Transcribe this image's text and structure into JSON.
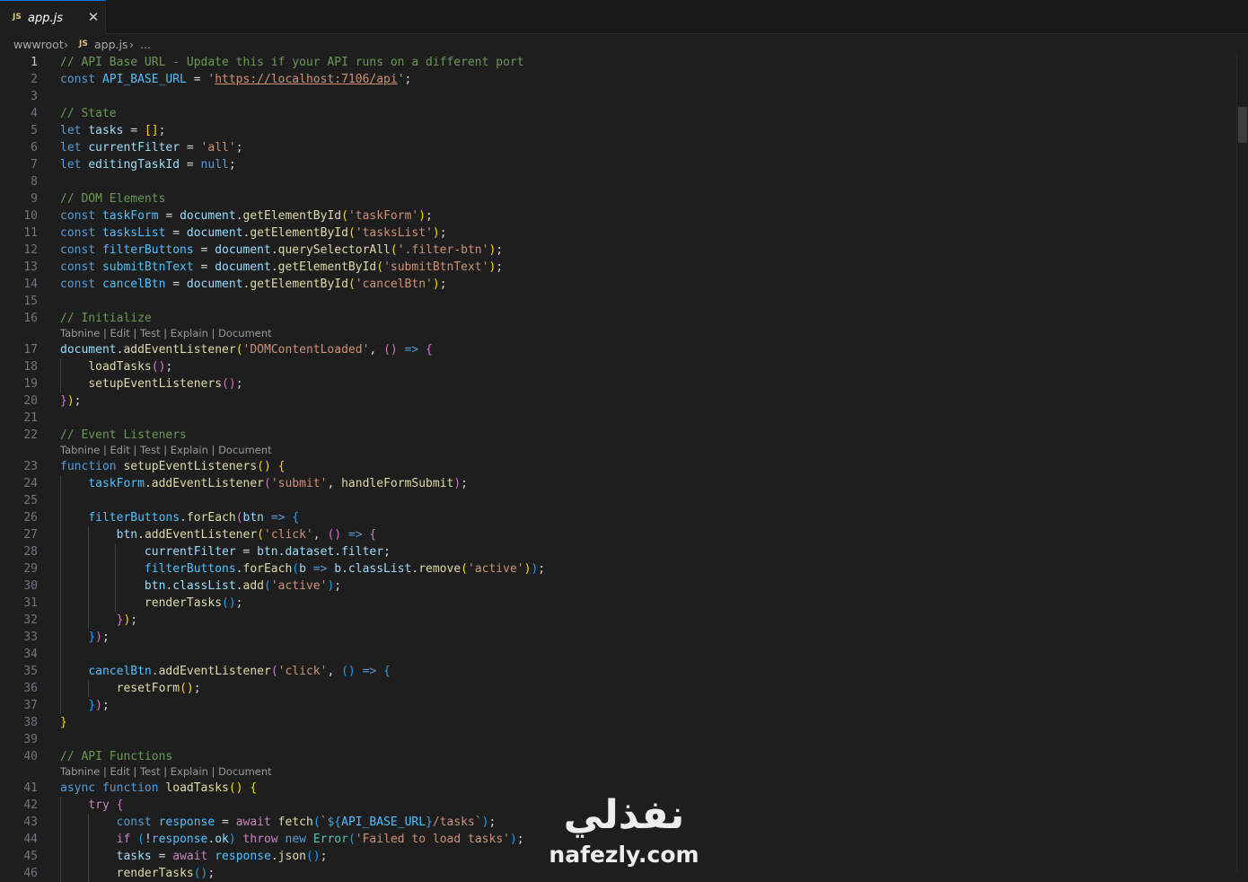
{
  "tab": {
    "file": "app.js",
    "lang_badge": "JS",
    "close_glyph": "✕"
  },
  "breadcrumb": {
    "root": "wwwroot",
    "sep": "›",
    "lang_badge": "JS",
    "file": "app.js",
    "more": "..."
  },
  "codelens_text": "Tabnine | Edit | Test | Explain | Document",
  "colors": {
    "comment": "#6a9955",
    "keyword": "#569cd6",
    "control": "#c586c0",
    "variable": "#9cdcfe",
    "constant": "#4fc1ff",
    "function": "#dcdcaa",
    "string": "#ce9178",
    "class": "#4ec9b0",
    "plain": "#d4d4d4",
    "bracket1": "#ffd700",
    "bracket2": "#da70d6",
    "bracket3": "#179fff"
  },
  "lines": [
    {
      "n": "1",
      "current": true,
      "tokens": [
        [
          "// API Base URL - Update this if your API runs on a different port",
          "comment"
        ]
      ]
    },
    {
      "n": "2",
      "tokens": [
        [
          "const ",
          "keyword"
        ],
        [
          "API_BASE_URL",
          "constant"
        ],
        [
          " = ",
          "plain"
        ],
        [
          "'",
          "string"
        ],
        [
          "https://localhost:7106/api",
          "string-link"
        ],
        [
          "'",
          "string"
        ],
        [
          ";",
          "plain"
        ]
      ]
    },
    {
      "n": "3",
      "tokens": []
    },
    {
      "n": "4",
      "tokens": [
        [
          "// State",
          "comment"
        ]
      ]
    },
    {
      "n": "5",
      "tokens": [
        [
          "let ",
          "keyword"
        ],
        [
          "tasks",
          "variable"
        ],
        [
          " = ",
          "plain"
        ],
        [
          "[]",
          "bracket1"
        ],
        [
          ";",
          "plain"
        ]
      ]
    },
    {
      "n": "6",
      "tokens": [
        [
          "let ",
          "keyword"
        ],
        [
          "currentFilter",
          "variable"
        ],
        [
          " = ",
          "plain"
        ],
        [
          "'all'",
          "string"
        ],
        [
          ";",
          "plain"
        ]
      ]
    },
    {
      "n": "7",
      "tokens": [
        [
          "let ",
          "keyword"
        ],
        [
          "editingTaskId",
          "variable"
        ],
        [
          " = ",
          "plain"
        ],
        [
          "null",
          "keyword"
        ],
        [
          ";",
          "plain"
        ]
      ]
    },
    {
      "n": "8",
      "tokens": []
    },
    {
      "n": "9",
      "tokens": [
        [
          "// DOM Elements",
          "comment"
        ]
      ]
    },
    {
      "n": "10",
      "tokens": [
        [
          "const ",
          "keyword"
        ],
        [
          "taskForm",
          "constant"
        ],
        [
          " = ",
          "plain"
        ],
        [
          "document",
          "variable"
        ],
        [
          ".",
          "plain"
        ],
        [
          "getElementById",
          "function"
        ],
        [
          "(",
          "bracket1"
        ],
        [
          "'taskForm'",
          "string"
        ],
        [
          ")",
          "bracket1"
        ],
        [
          ";",
          "plain"
        ]
      ]
    },
    {
      "n": "11",
      "tokens": [
        [
          "const ",
          "keyword"
        ],
        [
          "tasksList",
          "constant"
        ],
        [
          " = ",
          "plain"
        ],
        [
          "document",
          "variable"
        ],
        [
          ".",
          "plain"
        ],
        [
          "getElementById",
          "function"
        ],
        [
          "(",
          "bracket1"
        ],
        [
          "'tasksList'",
          "string"
        ],
        [
          ")",
          "bracket1"
        ],
        [
          ";",
          "plain"
        ]
      ]
    },
    {
      "n": "12",
      "tokens": [
        [
          "const ",
          "keyword"
        ],
        [
          "filterButtons",
          "constant"
        ],
        [
          " = ",
          "plain"
        ],
        [
          "document",
          "variable"
        ],
        [
          ".",
          "plain"
        ],
        [
          "querySelectorAll",
          "function"
        ],
        [
          "(",
          "bracket1"
        ],
        [
          "'.filter-btn'",
          "string"
        ],
        [
          ")",
          "bracket1"
        ],
        [
          ";",
          "plain"
        ]
      ]
    },
    {
      "n": "13",
      "tokens": [
        [
          "const ",
          "keyword"
        ],
        [
          "submitBtnText",
          "constant"
        ],
        [
          " = ",
          "plain"
        ],
        [
          "document",
          "variable"
        ],
        [
          ".",
          "plain"
        ],
        [
          "getElementById",
          "function"
        ],
        [
          "(",
          "bracket1"
        ],
        [
          "'submitBtnText'",
          "string"
        ],
        [
          ")",
          "bracket1"
        ],
        [
          ";",
          "plain"
        ]
      ]
    },
    {
      "n": "14",
      "tokens": [
        [
          "const ",
          "keyword"
        ],
        [
          "cancelBtn",
          "constant"
        ],
        [
          " = ",
          "plain"
        ],
        [
          "document",
          "variable"
        ],
        [
          ".",
          "plain"
        ],
        [
          "getElementById",
          "function"
        ],
        [
          "(",
          "bracket1"
        ],
        [
          "'cancelBtn'",
          "string"
        ],
        [
          ")",
          "bracket1"
        ],
        [
          ";",
          "plain"
        ]
      ]
    },
    {
      "n": "15",
      "tokens": []
    },
    {
      "n": "16",
      "tokens": [
        [
          "// Initialize",
          "comment"
        ]
      ],
      "lens_after": true
    },
    {
      "n": "17",
      "tokens": [
        [
          "document",
          "variable"
        ],
        [
          ".",
          "plain"
        ],
        [
          "addEventListener",
          "function"
        ],
        [
          "(",
          "bracket1"
        ],
        [
          "'DOMContentLoaded'",
          "string"
        ],
        [
          ", ",
          "plain"
        ],
        [
          "()",
          "bracket2"
        ],
        [
          " => ",
          "keyword"
        ],
        [
          "{",
          "bracket2"
        ]
      ]
    },
    {
      "n": "18",
      "tokens": [
        [
          "    ",
          "plain"
        ],
        [
          "loadTasks",
          "function"
        ],
        [
          "()",
          "bracket2"
        ],
        [
          ";",
          "plain"
        ]
      ]
    },
    {
      "n": "19",
      "tokens": [
        [
          "    ",
          "plain"
        ],
        [
          "setupEventListeners",
          "function"
        ],
        [
          "()",
          "bracket2"
        ],
        [
          ";",
          "plain"
        ]
      ]
    },
    {
      "n": "20",
      "tokens": [
        [
          "}",
          "bracket2"
        ],
        [
          ")",
          "bracket1"
        ],
        [
          ";",
          "plain"
        ]
      ]
    },
    {
      "n": "21",
      "tokens": []
    },
    {
      "n": "22",
      "tokens": [
        [
          "// Event Listeners",
          "comment"
        ]
      ],
      "lens_after": true
    },
    {
      "n": "23",
      "tokens": [
        [
          "function ",
          "keyword"
        ],
        [
          "setupEventListeners",
          "function"
        ],
        [
          "()",
          "bracket1"
        ],
        [
          " ",
          "plain"
        ],
        [
          "{",
          "bracket1"
        ]
      ]
    },
    {
      "n": "24",
      "tokens": [
        [
          "    ",
          "plain"
        ],
        [
          "taskForm",
          "constant"
        ],
        [
          ".",
          "plain"
        ],
        [
          "addEventListener",
          "function"
        ],
        [
          "(",
          "bracket2"
        ],
        [
          "'submit'",
          "string"
        ],
        [
          ", ",
          "plain"
        ],
        [
          "handleFormSubmit",
          "function"
        ],
        [
          ")",
          "bracket2"
        ],
        [
          ";",
          "plain"
        ]
      ]
    },
    {
      "n": "25",
      "tokens": []
    },
    {
      "n": "26",
      "tokens": [
        [
          "    ",
          "plain"
        ],
        [
          "filterButtons",
          "constant"
        ],
        [
          ".",
          "plain"
        ],
        [
          "forEach",
          "function"
        ],
        [
          "(",
          "bracket2"
        ],
        [
          "btn",
          "variable"
        ],
        [
          " => ",
          "keyword"
        ],
        [
          "{",
          "bracket3"
        ]
      ]
    },
    {
      "n": "27",
      "tokens": [
        [
          "        ",
          "plain"
        ],
        [
          "btn",
          "variable"
        ],
        [
          ".",
          "plain"
        ],
        [
          "addEventListener",
          "function"
        ],
        [
          "(",
          "bracket1"
        ],
        [
          "'click'",
          "string"
        ],
        [
          ", ",
          "plain"
        ],
        [
          "()",
          "bracket2"
        ],
        [
          " => ",
          "keyword"
        ],
        [
          "{",
          "bracket2"
        ]
      ]
    },
    {
      "n": "28",
      "tokens": [
        [
          "            ",
          "plain"
        ],
        [
          "currentFilter",
          "variable"
        ],
        [
          " = ",
          "plain"
        ],
        [
          "btn",
          "variable"
        ],
        [
          ".",
          "plain"
        ],
        [
          "dataset",
          "variable"
        ],
        [
          ".",
          "plain"
        ],
        [
          "filter",
          "variable"
        ],
        [
          ";",
          "plain"
        ]
      ]
    },
    {
      "n": "29",
      "tokens": [
        [
          "            ",
          "plain"
        ],
        [
          "filterButtons",
          "constant"
        ],
        [
          ".",
          "plain"
        ],
        [
          "forEach",
          "function"
        ],
        [
          "(",
          "bracket3"
        ],
        [
          "b",
          "variable"
        ],
        [
          " => ",
          "keyword"
        ],
        [
          "b",
          "variable"
        ],
        [
          ".",
          "plain"
        ],
        [
          "classList",
          "variable"
        ],
        [
          ".",
          "plain"
        ],
        [
          "remove",
          "function"
        ],
        [
          "(",
          "bracket1"
        ],
        [
          "'active'",
          "string"
        ],
        [
          ")",
          "bracket1"
        ],
        [
          ")",
          "bracket3"
        ],
        [
          ";",
          "plain"
        ]
      ]
    },
    {
      "n": "30",
      "tokens": [
        [
          "            ",
          "plain"
        ],
        [
          "btn",
          "variable"
        ],
        [
          ".",
          "plain"
        ],
        [
          "classList",
          "variable"
        ],
        [
          ".",
          "plain"
        ],
        [
          "add",
          "function"
        ],
        [
          "(",
          "bracket3"
        ],
        [
          "'active'",
          "string"
        ],
        [
          ")",
          "bracket3"
        ],
        [
          ";",
          "plain"
        ]
      ]
    },
    {
      "n": "31",
      "tokens": [
        [
          "            ",
          "plain"
        ],
        [
          "renderTasks",
          "function"
        ],
        [
          "()",
          "bracket3"
        ],
        [
          ";",
          "plain"
        ]
      ]
    },
    {
      "n": "32",
      "tokens": [
        [
          "        ",
          "plain"
        ],
        [
          "}",
          "bracket2"
        ],
        [
          ")",
          "bracket1"
        ],
        [
          ";",
          "plain"
        ]
      ]
    },
    {
      "n": "33",
      "tokens": [
        [
          "    ",
          "plain"
        ],
        [
          "}",
          "bracket3"
        ],
        [
          ")",
          "bracket2"
        ],
        [
          ";",
          "plain"
        ]
      ]
    },
    {
      "n": "34",
      "tokens": []
    },
    {
      "n": "35",
      "tokens": [
        [
          "    ",
          "plain"
        ],
        [
          "cancelBtn",
          "constant"
        ],
        [
          ".",
          "plain"
        ],
        [
          "addEventListener",
          "function"
        ],
        [
          "(",
          "bracket2"
        ],
        [
          "'click'",
          "string"
        ],
        [
          ", ",
          "plain"
        ],
        [
          "()",
          "bracket3"
        ],
        [
          " => ",
          "keyword"
        ],
        [
          "{",
          "bracket3"
        ]
      ]
    },
    {
      "n": "36",
      "tokens": [
        [
          "        ",
          "plain"
        ],
        [
          "resetForm",
          "function"
        ],
        [
          "()",
          "bracket1"
        ],
        [
          ";",
          "plain"
        ]
      ]
    },
    {
      "n": "37",
      "tokens": [
        [
          "    ",
          "plain"
        ],
        [
          "}",
          "bracket3"
        ],
        [
          ")",
          "bracket2"
        ],
        [
          ";",
          "plain"
        ]
      ]
    },
    {
      "n": "38",
      "tokens": [
        [
          "}",
          "bracket1"
        ]
      ]
    },
    {
      "n": "39",
      "tokens": []
    },
    {
      "n": "40",
      "tokens": [
        [
          "// API Functions",
          "comment"
        ]
      ],
      "lens_after": true
    },
    {
      "n": "41",
      "tokens": [
        [
          "async ",
          "keyword"
        ],
        [
          "function ",
          "keyword"
        ],
        [
          "loadTasks",
          "function"
        ],
        [
          "()",
          "bracket1"
        ],
        [
          " ",
          "plain"
        ],
        [
          "{",
          "bracket1"
        ]
      ]
    },
    {
      "n": "42",
      "tokens": [
        [
          "    ",
          "plain"
        ],
        [
          "try ",
          "control"
        ],
        [
          "{",
          "bracket2"
        ]
      ]
    },
    {
      "n": "43",
      "tokens": [
        [
          "        ",
          "plain"
        ],
        [
          "const ",
          "keyword"
        ],
        [
          "response",
          "constant"
        ],
        [
          " = ",
          "plain"
        ],
        [
          "await ",
          "control"
        ],
        [
          "fetch",
          "function"
        ],
        [
          "(",
          "bracket3"
        ],
        [
          "`",
          "string"
        ],
        [
          "${",
          "keyword"
        ],
        [
          "API_BASE_URL",
          "constant"
        ],
        [
          "}",
          "keyword"
        ],
        [
          "/tasks`",
          "string"
        ],
        [
          ")",
          "bracket3"
        ],
        [
          ";",
          "plain"
        ]
      ]
    },
    {
      "n": "44",
      "tokens": [
        [
          "        ",
          "plain"
        ],
        [
          "if ",
          "control"
        ],
        [
          "(",
          "bracket3"
        ],
        [
          "!",
          "plain"
        ],
        [
          "response",
          "constant"
        ],
        [
          ".",
          "plain"
        ],
        [
          "ok",
          "variable"
        ],
        [
          ")",
          "bracket3"
        ],
        [
          " ",
          "plain"
        ],
        [
          "throw ",
          "control"
        ],
        [
          "new ",
          "keyword"
        ],
        [
          "Error",
          "class"
        ],
        [
          "(",
          "bracket3"
        ],
        [
          "'Failed to load tasks'",
          "string"
        ],
        [
          ")",
          "bracket3"
        ],
        [
          ";",
          "plain"
        ]
      ]
    },
    {
      "n": "45",
      "tokens": [
        [
          "        ",
          "plain"
        ],
        [
          "tasks",
          "variable"
        ],
        [
          " = ",
          "plain"
        ],
        [
          "await ",
          "control"
        ],
        [
          "response",
          "constant"
        ],
        [
          ".",
          "plain"
        ],
        [
          "json",
          "function"
        ],
        [
          "()",
          "bracket3"
        ],
        [
          ";",
          "plain"
        ]
      ]
    },
    {
      "n": "46",
      "tokens": [
        [
          "        ",
          "plain"
        ],
        [
          "renderTasks",
          "function"
        ],
        [
          "()",
          "bracket3"
        ],
        [
          ";",
          "plain"
        ]
      ]
    }
  ],
  "watermark": {
    "arabic": "نفذلي",
    "url": "nafezly.com"
  }
}
